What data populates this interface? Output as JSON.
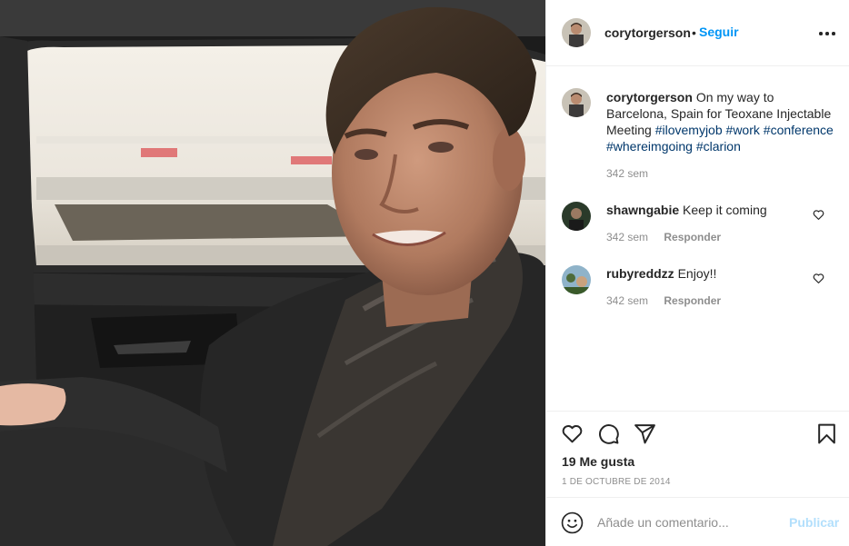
{
  "post": {
    "username": "corytorgerson",
    "dot": "•",
    "follow_label": "Seguir",
    "more_icon": "more-horizontal-icon"
  },
  "caption": {
    "username": "corytorgerson",
    "text": "On my way to Barcelona, Spain for Teoxane Injectable Meeting",
    "hashtags": [
      "#ilovemyjob",
      "#work",
      "#conference",
      "#whereimgoing",
      "#clarion"
    ],
    "time": "342 sem"
  },
  "comments": [
    {
      "username": "shawngabie",
      "text": "Keep it coming",
      "time": "342 sem",
      "reply_label": "Responder"
    },
    {
      "username": "rubyreddzz",
      "text": "Enjoy!!",
      "time": "342 sem",
      "reply_label": "Responder"
    }
  ],
  "actions": {
    "icons": [
      "heart-icon",
      "comment-icon",
      "share-icon",
      "bookmark-icon"
    ],
    "likes": "19 Me gusta",
    "date": "1 DE OCTUBRE DE 2014"
  },
  "add_comment": {
    "placeholder": "Añade un comentario...",
    "publish_label": "Publicar",
    "emoji_icon": "emoji-icon"
  },
  "colors": {
    "accent": "#0095f6",
    "hashtag": "#00376b",
    "muted": "#8e8e8e",
    "publish_disabled": "#b2dffc",
    "border": "#efefef"
  }
}
